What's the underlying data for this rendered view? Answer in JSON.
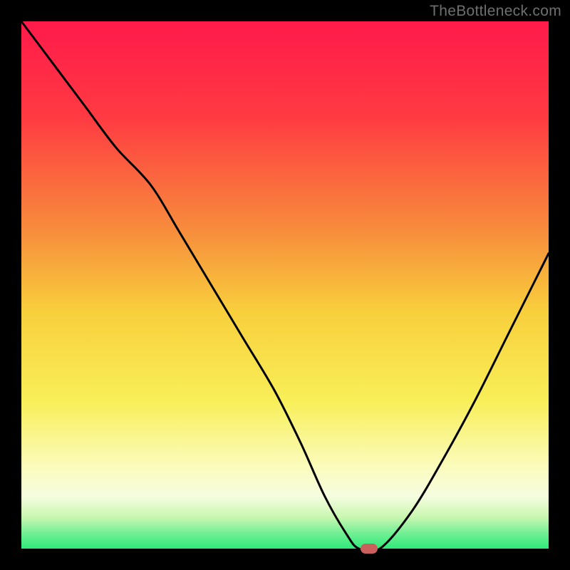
{
  "watermark": "TheBottleneck.com",
  "colors": {
    "brand_text": "#6f6f6f",
    "marker_fill": "#c9605c",
    "curve_stroke": "#000000",
    "gradient_top": "#ff1a4b",
    "gradient_mid_orange": "#f7a13a",
    "gradient_yellow": "#f8e83b",
    "gradient_pale": "#fdfccb",
    "gradient_green": "#2ee97a",
    "frame_black": "#000000"
  },
  "chart_data": {
    "type": "line",
    "title": "",
    "xlabel": "",
    "ylabel": "",
    "xlim": [
      0,
      100
    ],
    "ylim": [
      0,
      100
    ],
    "grid": false,
    "legend": false,
    "series": [
      {
        "name": "bottleneck_curve",
        "x": [
          0,
          6,
          12,
          18,
          24.5,
          30,
          36,
          42,
          48,
          53,
          57.5,
          61.5,
          64,
          68,
          74,
          80,
          86,
          92,
          97,
          100
        ],
        "values": [
          100,
          92,
          84,
          76,
          69,
          60,
          50,
          40,
          30,
          20,
          10,
          3,
          0,
          0,
          7,
          17,
          28,
          40,
          50,
          56
        ]
      }
    ],
    "marker": {
      "x": 66,
      "y": 0
    },
    "background_gradient": {
      "direction": "vertical",
      "stops": [
        {
          "pos": 0.0,
          "color": "#ff1a4b"
        },
        {
          "pos": 0.18,
          "color": "#ff3a42"
        },
        {
          "pos": 0.4,
          "color": "#f78e3c"
        },
        {
          "pos": 0.55,
          "color": "#f8cf3c"
        },
        {
          "pos": 0.72,
          "color": "#f8ef58"
        },
        {
          "pos": 0.84,
          "color": "#fbfbb9"
        },
        {
          "pos": 0.9,
          "color": "#f6fde0"
        },
        {
          "pos": 0.94,
          "color": "#c9f7b1"
        },
        {
          "pos": 0.97,
          "color": "#74ef95"
        },
        {
          "pos": 1.0,
          "color": "#2ee97a"
        }
      ]
    }
  }
}
